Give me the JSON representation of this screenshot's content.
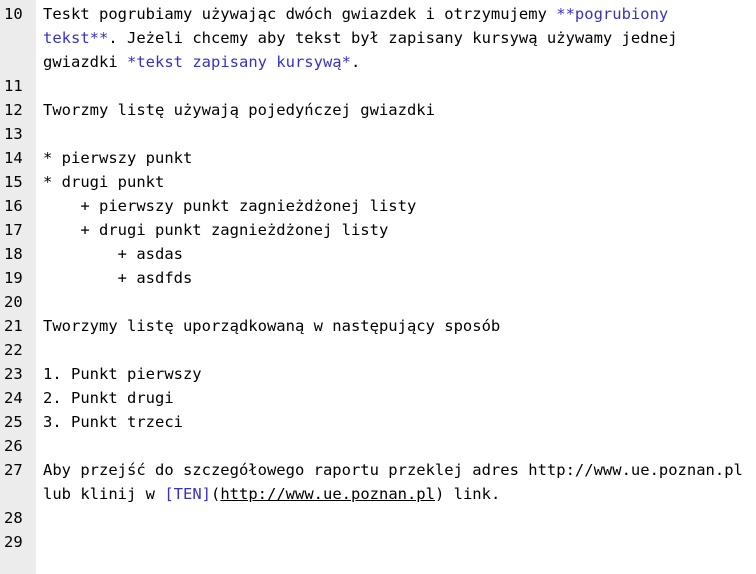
{
  "editor": {
    "lines": [
      {
        "n": "10",
        "segs": [
          {
            "t": "Teskt pogrubiamy używając dwóch gwiazdek i otrzymujemy "
          },
          {
            "t": "**pogrubiony tekst**",
            "c": "md-bold"
          },
          {
            "t": ". Jeżeli chcemy aby tekst był zapisany kursywą używamy jednej gwiazdki "
          },
          {
            "t": "*tekst zapisany kursywą*",
            "c": "md-italic"
          },
          {
            "t": "."
          }
        ]
      },
      {
        "n": "11",
        "segs": []
      },
      {
        "n": "12",
        "segs": [
          {
            "t": "Tworzmy listę używają pojedyńczej gwiazdki"
          }
        ]
      },
      {
        "n": "13",
        "segs": []
      },
      {
        "n": "14",
        "segs": [
          {
            "t": "* pierwszy punkt"
          }
        ]
      },
      {
        "n": "15",
        "segs": [
          {
            "t": "* drugi punkt"
          }
        ]
      },
      {
        "n": "16",
        "segs": [
          {
            "t": "    + pierwszy punkt zagnieżdżonej listy"
          }
        ]
      },
      {
        "n": "17",
        "segs": [
          {
            "t": "    + drugi punkt zagnieżdżonej listy"
          }
        ]
      },
      {
        "n": "18",
        "segs": [
          {
            "t": "        + asdas"
          }
        ]
      },
      {
        "n": "19",
        "segs": [
          {
            "t": "        + asdfds"
          }
        ]
      },
      {
        "n": "20",
        "segs": []
      },
      {
        "n": "21",
        "segs": [
          {
            "t": "Tworzymy listę uporządkowaną w następujący sposób"
          }
        ]
      },
      {
        "n": "22",
        "segs": []
      },
      {
        "n": "23",
        "segs": [
          {
            "t": "1. Punkt pierwszy"
          }
        ]
      },
      {
        "n": "24",
        "segs": [
          {
            "t": "2. Punkt drugi"
          }
        ]
      },
      {
        "n": "25",
        "segs": [
          {
            "t": "3. Punkt trzeci"
          }
        ]
      },
      {
        "n": "26",
        "segs": []
      },
      {
        "n": "27",
        "segs": [
          {
            "t": "Aby przejść do szczegółowego raportu przeklej adres http://www.ue.poznan.pl lub klinij w "
          },
          {
            "t": "[TEN]",
            "c": "md-link-text"
          },
          {
            "t": "("
          },
          {
            "t": "http://www.ue.poznan.pl",
            "c": "md-url"
          },
          {
            "t": ") link."
          }
        ]
      },
      {
        "n": "28",
        "segs": []
      },
      {
        "n": "29",
        "segs": []
      }
    ]
  }
}
